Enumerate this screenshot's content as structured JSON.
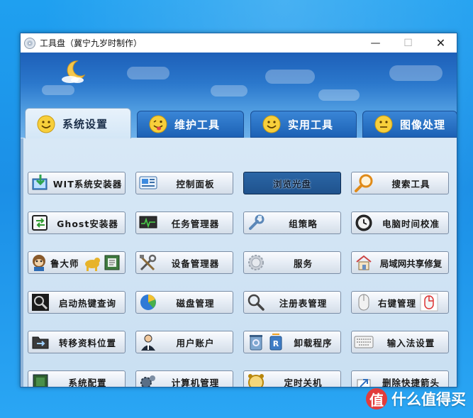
{
  "window": {
    "title": "工具盘（冀宁九岁时制作）",
    "controls": {
      "minimize": "—",
      "maximize": "☐",
      "close": "✕"
    }
  },
  "tabs": [
    {
      "label": "系统设置",
      "active": true
    },
    {
      "label": "维护工具",
      "active": false
    },
    {
      "label": "实用工具",
      "active": false
    },
    {
      "label": "图像处理",
      "active": false
    }
  ],
  "buttons": {
    "wit": {
      "label": "WIT系统安装器",
      "icon": "installer-icon"
    },
    "control_panel": {
      "label": "控制面板",
      "icon": "control-panel-icon"
    },
    "browse_disc": {
      "label": "浏览光盘",
      "icon": ""
    },
    "search_tool": {
      "label": "搜索工具",
      "icon": "magnifier-icon"
    },
    "ghost": {
      "label": "Ghost安装器",
      "icon": "ghost-icon"
    },
    "task_manager": {
      "label": "任务管理器",
      "icon": "task-monitor-icon"
    },
    "group_policy": {
      "label": "组策略",
      "icon": "wrench-icon"
    },
    "clock_sync": {
      "label": "电脑时间校准",
      "icon": "clock-icon"
    },
    "ludashi": {
      "label": "鲁大师",
      "icon": "monkey-icon"
    },
    "device_manager": {
      "label": "设备管理器",
      "icon": "tools-icon"
    },
    "services": {
      "label": "服务",
      "icon": "gear-icon"
    },
    "lan_repair": {
      "label": "局域网共享修复",
      "icon": "network-house-icon"
    },
    "hotkey_query": {
      "label": "启动热键查询",
      "icon": "magnifier-icon"
    },
    "disk_management": {
      "label": "磁盘管理",
      "icon": "pie-disk-icon"
    },
    "registry": {
      "label": "注册表管理",
      "icon": "magnifier-icon"
    },
    "right_click": {
      "label": "右键管理",
      "icon": "mouse-icon"
    },
    "relocate_folders": {
      "label": "转移资料位置",
      "icon": "folder-icon"
    },
    "user_accounts": {
      "label": "用户账户",
      "icon": "user-icon"
    },
    "uninstall": {
      "label": "卸载程序",
      "icon": "uninstall-icon"
    },
    "ime_settings": {
      "label": "输入法设置",
      "icon": "keyboard-icon"
    },
    "sys_config": {
      "label": "系统配置",
      "icon": "chip-icon"
    },
    "computer_management": {
      "label": "计算机管理",
      "icon": "gear-icon"
    },
    "shutdown_timer": {
      "label": "定时关机",
      "icon": "alarm-clock-icon"
    },
    "remove_shortcut_arrow": {
      "label": "删除快捷箭头",
      "icon": "arrow-icon"
    }
  },
  "watermark": {
    "logo": "值",
    "text": "什么值得买"
  },
  "colors": {
    "desktop": "#1b8fe6",
    "banner": "#2b78cc",
    "panel": "#d8e8f6",
    "selected_button": "#1f528d"
  }
}
